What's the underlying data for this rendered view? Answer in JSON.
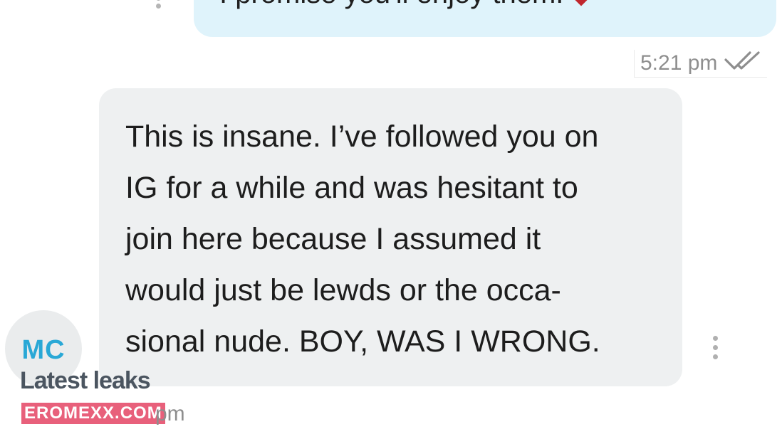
{
  "outgoing_message": {
    "text": "I promise you'll enjoy them.",
    "icon": "heart-icon",
    "time": "5:21 pm",
    "status_icon": "double-check-icon",
    "menu_icon": "more-vert-icon"
  },
  "incoming_message": {
    "lines": [
      "This is insane. I’ve followed you on",
      "IG for a while and was hesitant to",
      "join here because I assumed it",
      "would just be lewds or the occa-",
      "sional nude. BOY, WAS I WRONG."
    ],
    "menu_icon": "more-vert-icon",
    "time_partial": "pm"
  },
  "avatar": {
    "initials": "MC"
  },
  "watermark": {
    "title": "Latest leaks",
    "badge": "EROMEXX.COM"
  },
  "colors": {
    "outgoing_bubble": "#dff3fb",
    "incoming_bubble": "#eef0f1",
    "avatar_initials": "#29a8d6",
    "heart": "#c0262d",
    "watermark_badge": "#e8607b"
  }
}
